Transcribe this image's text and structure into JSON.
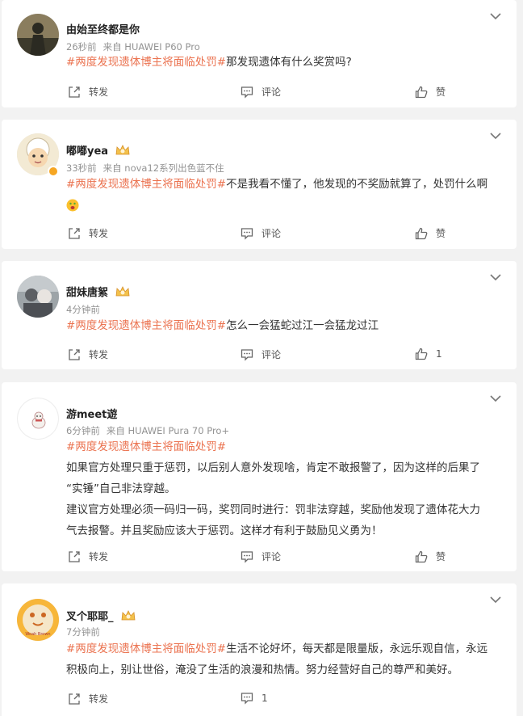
{
  "actions": {
    "share_label": "转发",
    "comment_label": "评论"
  },
  "posts": [
    {
      "username": "由始至终都是你",
      "time": "26秒前",
      "source": "来自 HUAWEI P60 Pro",
      "topic": "#两度发现遗体博主将面临处罚#",
      "body": "那发现遗体有什么奖赏吗?",
      "like_label": "赞"
    },
    {
      "username": "嘟嘟yea",
      "time": "33秒前",
      "source": "来自 nova12系列出色蓝不住",
      "topic": "#两度发现遗体博主将面临处罚#",
      "body": "不是我看不懂了，他发现的不奖励就算了，处罚什么啊",
      "like_label": "赞"
    },
    {
      "username": "甜妹唐絮",
      "time": "4分钟前",
      "source": "",
      "topic": "#两度发现遗体博主将面临处罚#",
      "body": "怎么一会猛蛇过江一会猛龙过江",
      "like_label": "1"
    },
    {
      "username": "游meet遊",
      "time": "6分钟前",
      "source": "来自 HUAWEI Pura 70 Pro+",
      "topic": "#两度发现遗体博主将面临处罚#",
      "body_line1": "如果官方处理只重于惩罚，以后别人意外发现啥，肯定不敢报警了，因为这样的后果了",
      "body_line2": "“实锤”自己非法穿越。",
      "body_line3": "建议官方处理必须一码归一码，奖罚同时进行：罚非法穿越，奖励他发现了遗体花大力",
      "body_line4": "气去报警。并且奖励应该大于惩罚。这样才有利于鼓励见义勇为！",
      "like_label": "赞"
    },
    {
      "username": "叉个耶耶_",
      "time": "7分钟前",
      "source": "",
      "topic": "#两度发现遗体博主将面临处罚#",
      "body_line1": "生活不论好坏，每天都是限量版，永远乐观自信，永远",
      "body_line2": "积极向上，别让世俗，淹没了生活的浪漫和热情。努力经营好自己的尊严和美好。",
      "avatar_text": "Woah Brown",
      "comment_count": "1",
      "like_label": ""
    }
  ]
}
